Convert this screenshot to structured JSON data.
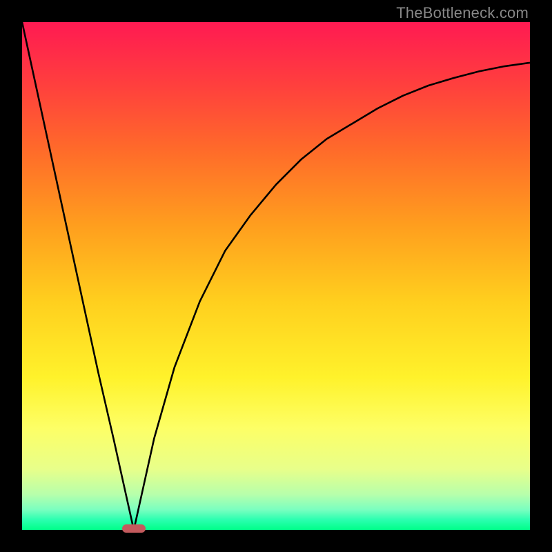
{
  "watermark": "TheBottleneck.com",
  "chart_data": {
    "type": "line",
    "title": "",
    "xlabel": "",
    "ylabel": "",
    "xlim": [
      0,
      100
    ],
    "ylim": [
      0,
      100
    ],
    "grid": false,
    "legend": false,
    "annotations": [
      {
        "name": "optimal-marker",
        "x": 22,
        "y": 0
      }
    ],
    "series": [
      {
        "name": "bottleneck-curve",
        "x": [
          0,
          5,
          10,
          15,
          18,
          20,
          22,
          24,
          26,
          30,
          35,
          40,
          45,
          50,
          55,
          60,
          65,
          70,
          75,
          80,
          85,
          90,
          95,
          100
        ],
        "y": [
          100,
          77,
          54,
          31,
          18,
          9,
          0,
          9,
          18,
          32,
          45,
          55,
          62,
          68,
          73,
          77,
          80,
          83,
          85.5,
          87.5,
          89,
          90.3,
          91.3,
          92
        ]
      }
    ]
  },
  "colors": {
    "curve": "#000000",
    "marker": "#c45a5d",
    "background_top": "#ff1a52",
    "background_bottom": "#00ff88",
    "frame": "#000000"
  }
}
